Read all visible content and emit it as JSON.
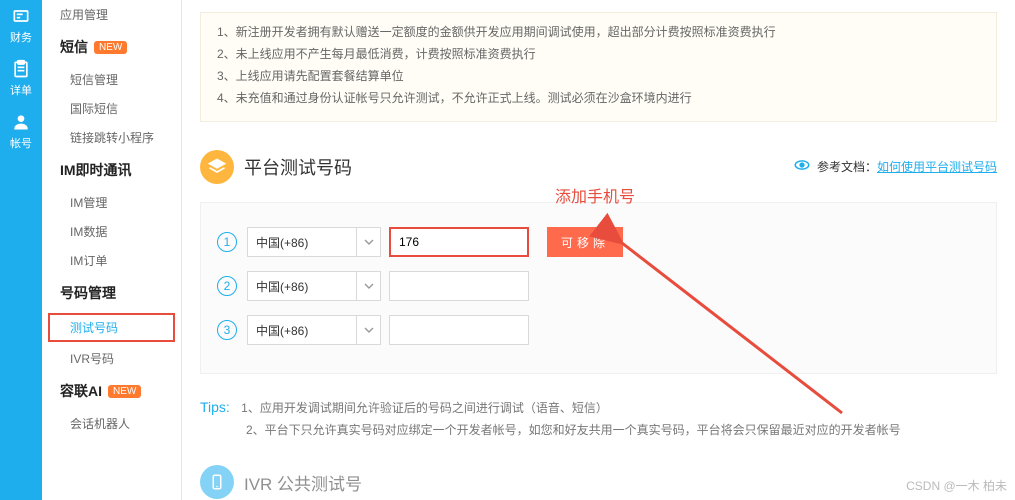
{
  "rail": [
    {
      "label": "财务",
      "icon": "money-icon"
    },
    {
      "label": "详单",
      "icon": "clipboard-icon"
    },
    {
      "label": "帐号",
      "icon": "user-icon"
    }
  ],
  "sidebar": {
    "top_item": "应用管理",
    "groups": [
      {
        "title": "短信",
        "badge": "NEW",
        "items": [
          "短信管理",
          "国际短信",
          "链接跳转小程序"
        ]
      },
      {
        "title": "IM即时通讯",
        "items": [
          "IM管理",
          "IM数据",
          "IM订单"
        ]
      },
      {
        "title": "号码管理",
        "items": [
          {
            "label": "测试号码",
            "active": true
          },
          {
            "label": "IVR号码"
          }
        ]
      },
      {
        "title": "容联AI",
        "badge": "NEW",
        "items": [
          "会话机器人"
        ]
      }
    ]
  },
  "notice": [
    "1、新注册开发者拥有默认赠送一定额度的金额供开发应用期间调试使用，超出部分计费按照标准资费执行",
    "2、未上线应用不产生每月最低消费，计费按照标准资费执行",
    "3、上线应用请先配置套餐结算单位",
    "4、未充值和通过身份认证帐号只允许测试，不允许正式上线。测试必须在沙盒环境内进行"
  ],
  "section": {
    "title": "平台测试号码",
    "ref_label": "参考文档：",
    "ref_link": "如何使用平台测试号码"
  },
  "annotation": "添加手机号",
  "rows": [
    {
      "num": "1",
      "country": "中国(+86)",
      "phone": "176",
      "remove": "可移除",
      "highlight": true
    },
    {
      "num": "2",
      "country": "中国(+86)",
      "phone": ""
    },
    {
      "num": "3",
      "country": "中国(+86)",
      "phone": ""
    }
  ],
  "tips": {
    "label": "Tips:",
    "lines": [
      "1、应用开发调试期间允许验证后的号码之间进行调试（语音、短信）",
      "2、平台下只允许真实号码对应绑定一个开发者帐号，如您和好友共用一个真实号码，平台将会只保留最近对应的开发者帐号"
    ]
  },
  "next_title": "IVR 公共测试号",
  "watermark": "CSDN @一木 柏未"
}
